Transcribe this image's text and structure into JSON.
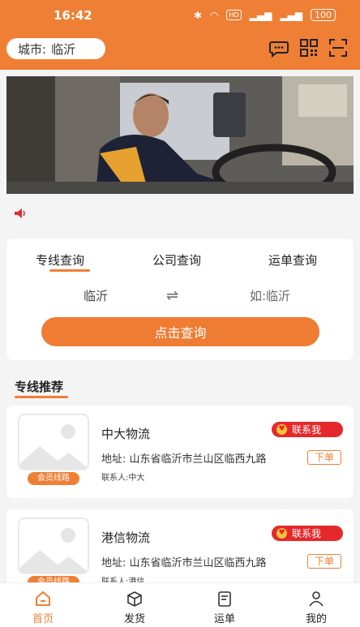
{
  "status": {
    "time": "16:42",
    "battery": "100",
    "hd": "HD"
  },
  "header": {
    "city_label": "城市:",
    "city_value": "临沂",
    "icons": [
      "chat-icon",
      "qrcode-icon",
      "scan-icon"
    ]
  },
  "search": {
    "tabs": [
      "专线查询",
      "公司查询",
      "运单查询"
    ],
    "from": "临沂",
    "to_placeholder": "如:临沂",
    "swap": "⇌",
    "button": "点击查询"
  },
  "recommend": {
    "title": "专线推荐",
    "items": [
      {
        "name": "中大物流",
        "address": "地址:  山东省临沂市兰山区临西九路",
        "contact": "联系人:中大",
        "badge": "会员线路",
        "call": "联系我",
        "order": "下单"
      },
      {
        "name": "港信物流",
        "address": "地址:  山东省临沂市兰山区临西九路",
        "contact": "联系人:港信",
        "badge": "会员线路",
        "call": "联系我",
        "order": "下单"
      }
    ]
  },
  "nav": [
    {
      "label": "首页",
      "icon": "home-icon",
      "active": true
    },
    {
      "label": "发货",
      "icon": "box-icon",
      "active": false
    },
    {
      "label": "运单",
      "icon": "waybill-icon",
      "active": false
    },
    {
      "label": "我的",
      "icon": "user-icon",
      "active": false
    }
  ],
  "colors": {
    "accent": "#ef7f35",
    "red": "#e5292b"
  }
}
